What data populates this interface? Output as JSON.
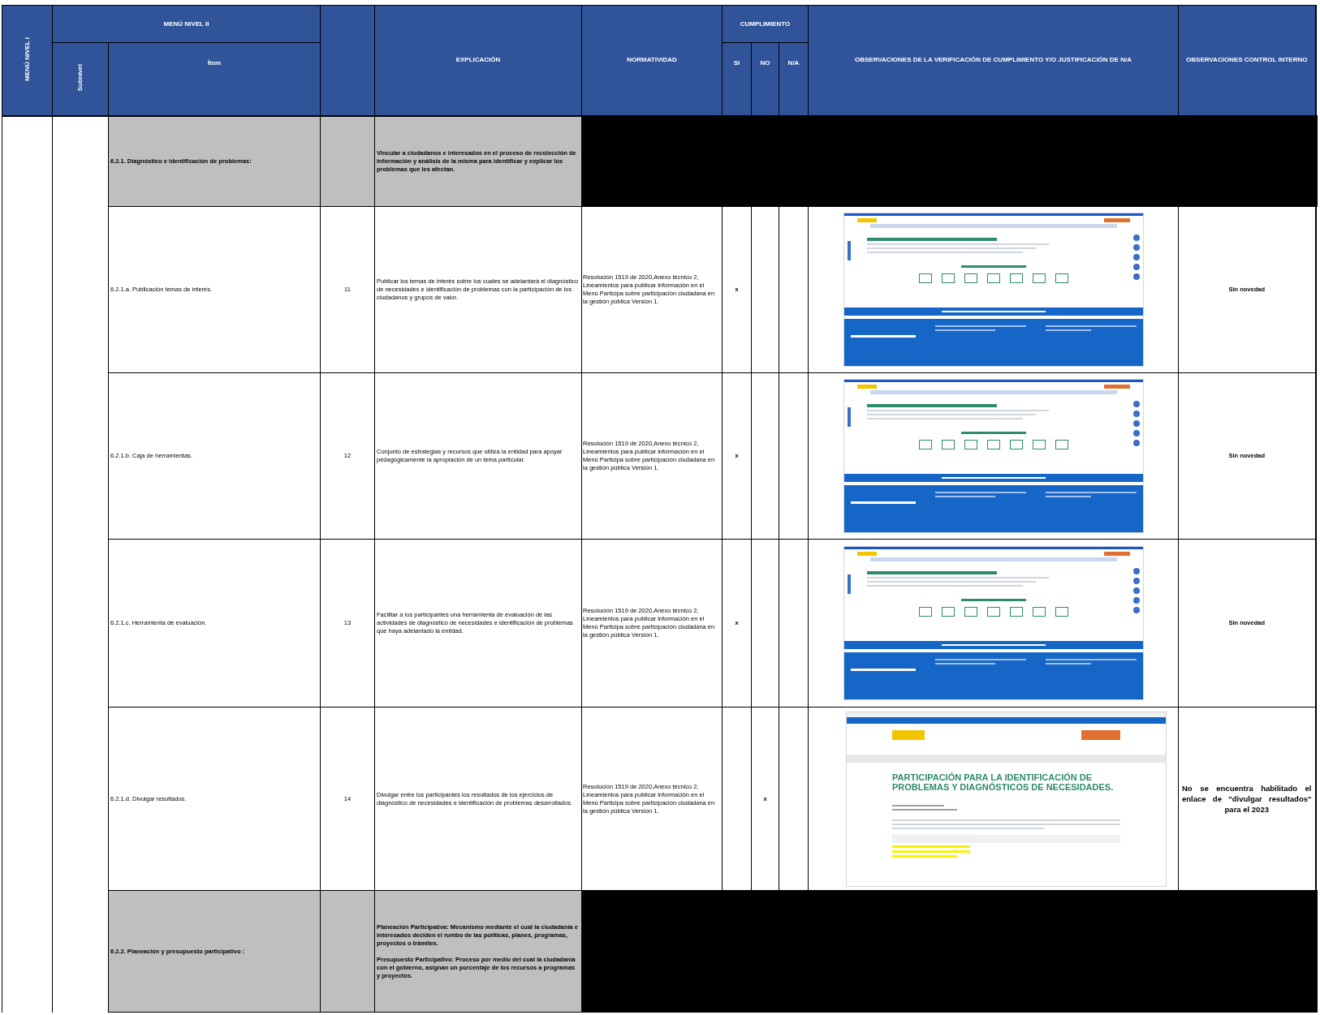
{
  "header": {
    "menu_level_1": "MENÚ NIVEL I",
    "menu_level_2": "MENÚ NIVEL II",
    "sublevel": "Subnivel",
    "item": "Ítem",
    "explanation": "EXPLICACIÓN",
    "regulation": "NORMATIVIDAD",
    "compliance": "CUMPLIMIENTO",
    "yes": "SI",
    "no": "NO",
    "na": "N/A",
    "observations": "OBSERVACIONES DE LA VERIFICACIÓN DE CUMPLIMIENTO Y/O JUSTIFICACIÓN DE N/A",
    "internal_control": "OBSERVACIONES CONTROL INTERNO"
  },
  "rows": [
    {
      "kind": "group",
      "item": "6.2.1. Diagnóstico e identificación de problemas:",
      "explanation": [
        "Vincular a ciudadanos e interesados en el proceso de recolección  de información y análisis de la misma para identificar y explicar los problemas que les afectan."
      ]
    },
    {
      "kind": "item",
      "item": "6.2.1.a. Publicación temas de interés.",
      "number": "11",
      "explanation": [
        "Publicar los temas de interés sobre los cuales se adelantará el diagnóstico de necesidades e identificación de problemas con la participación de los ciudadanos y grupos de valor."
      ],
      "regulation": "Resolución 1519 de 2020,Anexo técnico 2, Lineamientos para publicar información en el Menú Participa sobre participación ciudadana en la gestión pública Versión 1.",
      "checks": [
        true,
        false,
        false
      ],
      "mark": "x",
      "evidence": {
        "kind": "portal"
      },
      "control": "Sin novedad"
    },
    {
      "kind": "item",
      "item": "6.2.1.b. Caja de herramientas.",
      "number": "12",
      "explanation": [
        "Conjunto de estrategias y recursos que utiliza la entidad para apoyar pedagógicamente la apropiación de un tema particular."
      ],
      "regulation": "Resolución 1519 de 2020,Anexo técnico 2, Lineamientos para publicar información en el Menú Participa sobre participación ciudadana en la gestión pública Versión 1.",
      "checks": [
        true,
        false,
        false
      ],
      "mark": "x",
      "evidence": {
        "kind": "portal"
      },
      "control": "Sin novedad"
    },
    {
      "kind": "item",
      "item": "6.2.1.c. Herramienta de evaluación.",
      "number": "13",
      "explanation": [
        "Facilitar a los participantes una herramienta de evaluación de las actividades de diagnóstico de necesidades e identificación de problemas que haya adelantado la entidad."
      ],
      "regulation": "Resolución 1519 de 2020,Anexo técnico 2, Lineamientos para publicar información en el Menú Participa sobre participación ciudadana en la gestión pública Versión 1.",
      "checks": [
        true,
        false,
        false
      ],
      "mark": "x",
      "evidence": {
        "kind": "portal"
      },
      "control": "Sin novedad"
    },
    {
      "kind": "item",
      "item": "6.2.1.d. Divulgar resultados.",
      "number": "14",
      "explanation": [
        "Divulgar entre los participantes los resultados de los ejercicios de diagnóstico de necesidades e identificación de problemas desarrollados."
      ],
      "regulation": "Resolución 1519 de 2020,Anexo técnico 2, Lineamientos para publicar información en el Menú Participa sobre participación ciudadana en la gestión pública Versión 1.",
      "checks": [
        false,
        true,
        false
      ],
      "mark": "x",
      "evidence": {
        "kind": "browser",
        "title": "PARTICIPACIÓN PARA LA IDENTIFICACIÓN DE PROBLEMAS Y DIAGNÓSTICOS DE NECESIDADES."
      },
      "control": "No se encuentra habilitado el enlace de \"divulgar resultados\" para el 2023"
    },
    {
      "kind": "group",
      "item": "6.2.2. Planeación y presupuesto participativo :",
      "explanation": [
        "Planeación Participativa: Mecanismo mediante el cual la ciudadanía e interesados deciden el rumbo de las políticas, planes, programas, proyectos o trámites.",
        "Presupuesto Participativo: Proceso por medio del cual la ciudadanía con el gobierno, asignan un porcentaje de los recursos a programas y proyectos."
      ]
    }
  ]
}
